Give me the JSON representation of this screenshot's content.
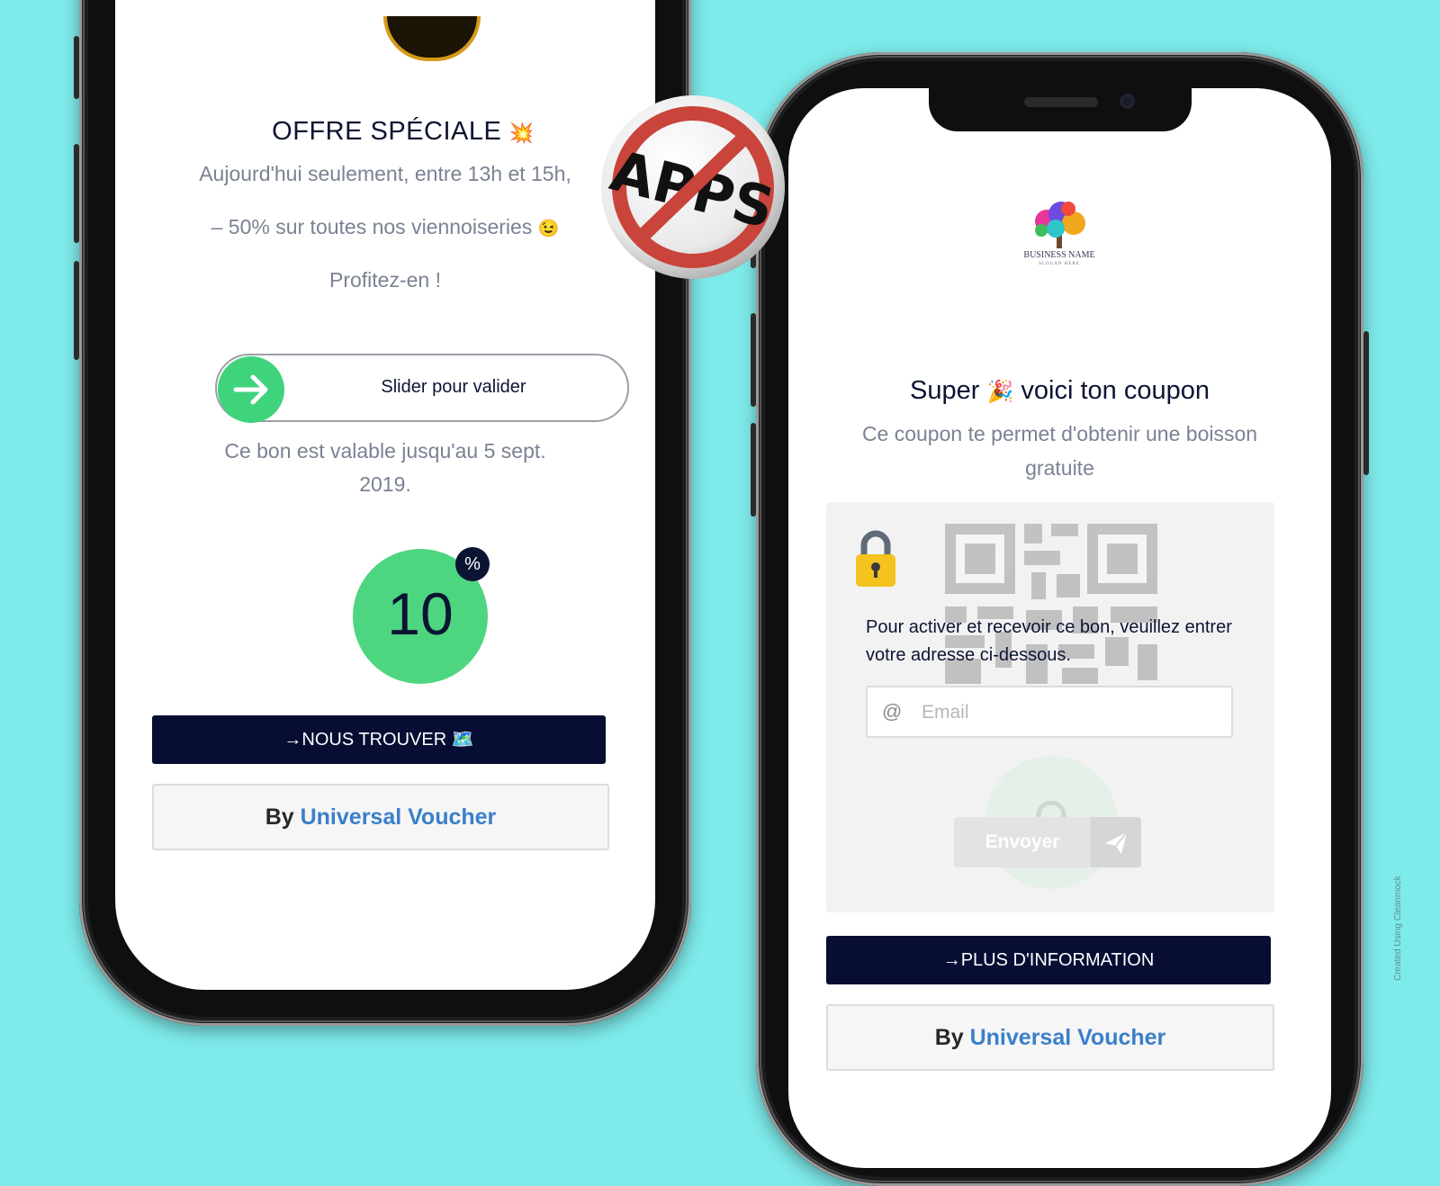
{
  "left_screen": {
    "offer_title": "OFFRE SPÉCIALE",
    "offer_emoji": "💥",
    "offer_line1": "Aujourd'hui seulement, entre 13h et 15h,",
    "offer_line2": "– 50% sur toutes nos viennoiseries",
    "offer_line2_emoji": "😉",
    "offer_line3": "Profitez-en !",
    "slider_label": "Slider pour valider",
    "validity_line1": "Ce bon est valable jusqu'au 5 sept.",
    "validity_line2": "2019.",
    "discount_value": "10",
    "discount_unit": "%",
    "find_button": "→NOUS TROUVER 🗺️",
    "by_label": "By",
    "by_brand": "Universal Voucher"
  },
  "right_screen": {
    "business_name": "BUSINESS NAME",
    "business_slogan": "SLOGAN HERE",
    "title_before": "Super",
    "title_emoji": "🎉",
    "title_after": "voici ton coupon",
    "description": "Ce coupon te permet d'obtenir une boisson gratuite",
    "lock_text": "Pour activer et recevoir ce bon, veuillez entrer votre adresse ci-dessous.",
    "email_icon": "@",
    "email_placeholder": "Email",
    "email_value": "",
    "send_button": "Envoyer",
    "info_button": "→PLUS D'INFORMATION",
    "by_label": "By",
    "by_brand": "Universal Voucher"
  },
  "no_apps_badge": "APPS",
  "credit": "Created Using Cleanmock",
  "colors": {
    "background": "#7eeaea",
    "navy": "#070d33",
    "green": "#4ed57f",
    "brand_blue": "#3a7fcb",
    "grey_text": "#7a8293",
    "prohibition_red": "#c9443a"
  }
}
